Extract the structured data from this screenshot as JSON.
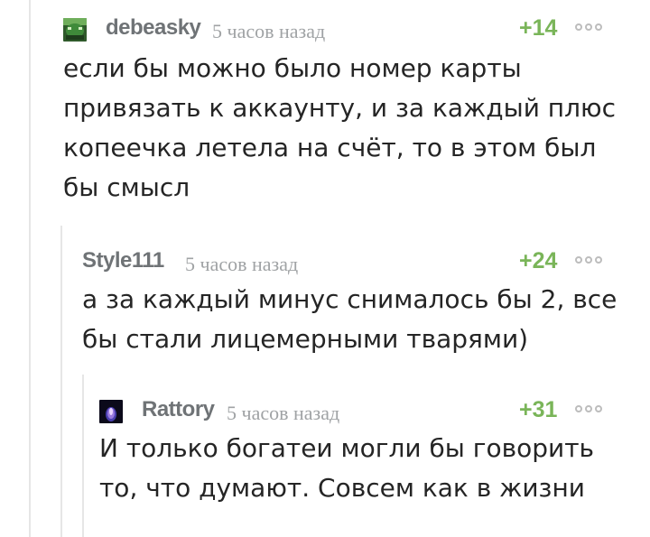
{
  "comments": [
    {
      "username": "debeasky",
      "time": "5 часов назад",
      "rating": "+14",
      "avatar_icon": "green-creature-avatar",
      "text": "если бы можно было номер карты\nпривязать к аккаунту, и за каждый плюс\nкопеечка летела на счёт, то в этом был\nбы смысл"
    },
    {
      "username": "Style111",
      "time": "5 часов назад",
      "rating": "+24",
      "text": "а за каждый минус снималось бы 2, все\nбы стали лицемерными тварями)"
    },
    {
      "username": "Rattory",
      "time": "5 часов назад",
      "rating": "+31",
      "avatar_icon": "blue-flame-avatar",
      "text": "И только богатеи могли бы говорить\nто, что думают. Совсем как в жизни"
    }
  ],
  "colors": {
    "username": "#6f7376",
    "timestamp": "#a0a3a5",
    "rating_positive": "#7ab559",
    "thread_line": "#e6e6e6",
    "text": "#252525"
  }
}
